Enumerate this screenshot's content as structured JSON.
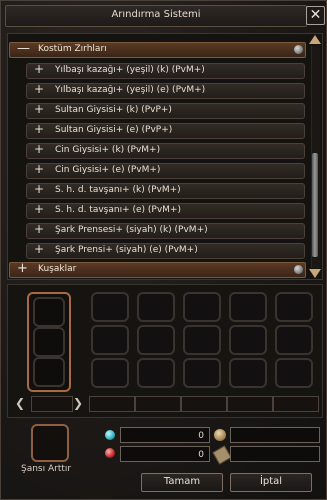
{
  "window": {
    "title": "Arındırma Sistemi",
    "close_icon": "close-icon"
  },
  "list": {
    "group_open": {
      "sign": "—",
      "label": "Kostüm Zırhları"
    },
    "items": [
      {
        "sign": "+",
        "label": "Yılbaşı kazağı+ (yeşil) (k) (PvM+)"
      },
      {
        "sign": "+",
        "label": "Yılbaşı kazağı+ (yeşil) (e) (PvM+)"
      },
      {
        "sign": "+",
        "label": "Sultan Giysisi+ (k) (PvP+)"
      },
      {
        "sign": "+",
        "label": "Sultan Giysisi+ (e) (PvP+)"
      },
      {
        "sign": "+",
        "label": "Cin Giysisi+ (k) (PvM+)"
      },
      {
        "sign": "+",
        "label": "Cin Giysisi+ (e) (PvM+)"
      },
      {
        "sign": "+",
        "label": "S. h. d. tavşanı+ (k) (PvM+)"
      },
      {
        "sign": "+",
        "label": "S. h. d. tavşanı+ (e) (PvM+)"
      },
      {
        "sign": "+",
        "label": "Şark Prensesi+ (siyah) (k) (PvM+)"
      },
      {
        "sign": "+",
        "label": "Şark Prensi+ (siyah) (e) (PvM+)"
      }
    ],
    "group_closed": {
      "sign": "+",
      "label": "Kuşaklar"
    }
  },
  "bottom": {
    "chance_label": "Şansı Arttır",
    "nav_left": "❮",
    "nav_right": "❯",
    "field1_value": "0",
    "field2_value": "0",
    "ok_button": "Tamam",
    "cancel_button": "İptal"
  },
  "colors": {
    "accent": "#a86a45",
    "group_bg": "#4a2f1e",
    "gem1": "#2bb3c0",
    "gem2": "#c02828"
  }
}
